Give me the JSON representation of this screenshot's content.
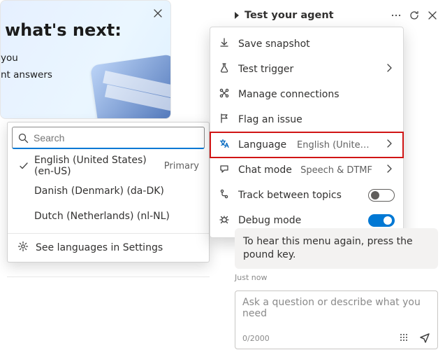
{
  "left": {
    "heading": "what's next:",
    "sub1": "you",
    "sub2": "nt answers"
  },
  "lang_popup": {
    "search_placeholder": "Search",
    "items": [
      {
        "label": "English (United States) (en-US)",
        "tag": "Primary",
        "selected": true
      },
      {
        "label": "Danish (Denmark) (da-DK)",
        "tag": "",
        "selected": false
      },
      {
        "label": "Dutch (Netherlands) (nl-NL)",
        "tag": "",
        "selected": false
      }
    ],
    "footer": "See languages in Settings"
  },
  "test_header": {
    "title": "Test your agent"
  },
  "menu": {
    "save_snapshot": "Save snapshot",
    "test_trigger": "Test trigger",
    "manage_connections": "Manage connections",
    "flag_issue": "Flag an issue",
    "language_label": "Language",
    "language_value": "English (United …",
    "chat_mode_label": "Chat mode",
    "chat_mode_value": "Speech & DTMF",
    "track_topics": "Track between topics",
    "debug_mode": "Debug mode"
  },
  "chat": {
    "bubble": "To hear this menu again, press the pound key.",
    "timestamp": "Just now",
    "placeholder": "Ask a question or describe what you need",
    "counter": "0/2000"
  }
}
